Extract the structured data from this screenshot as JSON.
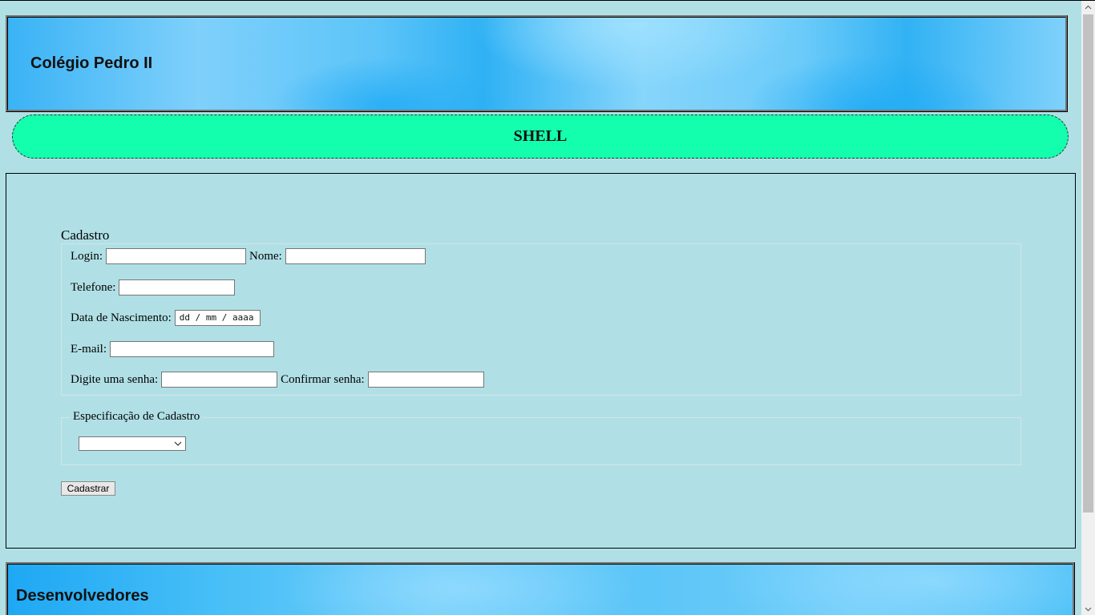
{
  "header": {
    "title": "Colégio Pedro II"
  },
  "banner": {
    "title": "SHELL"
  },
  "form": {
    "legend": "Cadastro",
    "login_label": "Login:",
    "login_value": "",
    "nome_label": "Nome:",
    "nome_value": "",
    "telefone_label": "Telefone:",
    "telefone_value": "",
    "nascimento_label": "Data de Nascimento:",
    "nascimento_placeholder": "dd / mm / aaaa",
    "email_label": "E-mail:",
    "email_value": "",
    "senha_label": "Digite uma senha:",
    "senha_value": "",
    "confirmar_label": "Confirmar senha:",
    "confirmar_value": ""
  },
  "spec": {
    "legend": "Especificação de Cadastro",
    "selected": "",
    "icon": "chevron-down-icon"
  },
  "submit": {
    "label": "Cadastrar"
  },
  "footer": {
    "title": "Desenvolvedores"
  },
  "colors": {
    "page_background": "#b0e0e6",
    "banner_background": "#14ffad",
    "header_blue": "#3ab3f5"
  }
}
